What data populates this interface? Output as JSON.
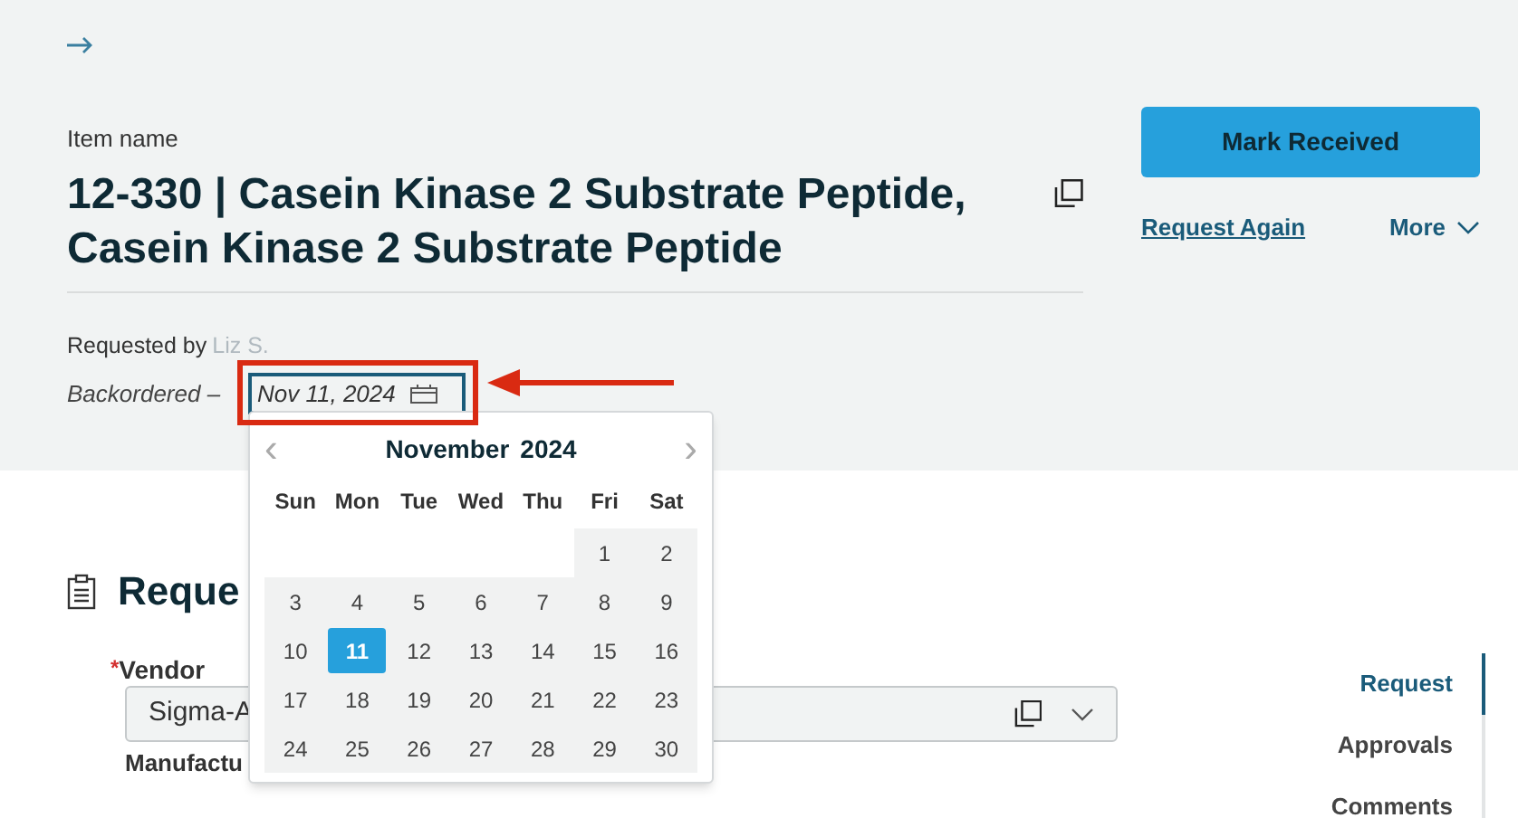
{
  "header": {
    "item_label": "Item name",
    "title": "12-330 | Casein Kinase 2 Substrate Peptide, Casein Kinase 2 Substrate Peptide",
    "requested_by_label": "Requested by",
    "requested_by": "Liz S.",
    "status": "Backordered –",
    "date_value": "Nov 11, 2024"
  },
  "actions": {
    "primary": "Mark Received",
    "link": "Request Again",
    "more": "More"
  },
  "section": {
    "title": "Reque",
    "vendor_label": "Vendor",
    "required_mark": "*",
    "vendor_value": "Sigma-A",
    "next_label": "Manufactu"
  },
  "nav": [
    {
      "label": "Request",
      "selected": true
    },
    {
      "label": "Approvals",
      "selected": false
    },
    {
      "label": "Comments",
      "selected": false
    }
  ],
  "calendar": {
    "month": "November",
    "year": "2024",
    "prev": "‹",
    "next": "›",
    "weekdays": [
      "Sun",
      "Mon",
      "Tue",
      "Wed",
      "Thu",
      "Fri",
      "Sat"
    ],
    "weeks": [
      [
        {
          "label": "1",
          "selected": false
        },
        {
          "label": "2",
          "selected": false
        }
      ],
      [
        {
          "label": "3",
          "selected": false
        },
        {
          "label": "4",
          "selected": false
        },
        {
          "label": "5",
          "selected": false
        },
        {
          "label": "6",
          "selected": false
        },
        {
          "label": "7",
          "selected": false
        },
        {
          "label": "8",
          "selected": false
        },
        {
          "label": "9",
          "selected": false
        }
      ],
      [
        {
          "label": "10",
          "selected": false
        },
        {
          "label": "11",
          "selected": true
        },
        {
          "label": "12",
          "selected": false
        },
        {
          "label": "13",
          "selected": false
        },
        {
          "label": "14",
          "selected": false
        },
        {
          "label": "15",
          "selected": false
        },
        {
          "label": "16",
          "selected": false
        }
      ],
      [
        {
          "label": "17",
          "selected": false
        },
        {
          "label": "18",
          "selected": false
        },
        {
          "label": "19",
          "selected": false
        },
        {
          "label": "20",
          "selected": false
        },
        {
          "label": "21",
          "selected": false
        },
        {
          "label": "22",
          "selected": false
        },
        {
          "label": "23",
          "selected": false
        }
      ],
      [
        {
          "label": "24",
          "selected": false
        },
        {
          "label": "25",
          "selected": false
        },
        {
          "label": "26",
          "selected": false
        },
        {
          "label": "27",
          "selected": false
        },
        {
          "label": "28",
          "selected": false
        },
        {
          "label": "29",
          "selected": false
        },
        {
          "label": "30",
          "selected": false
        }
      ]
    ]
  }
}
